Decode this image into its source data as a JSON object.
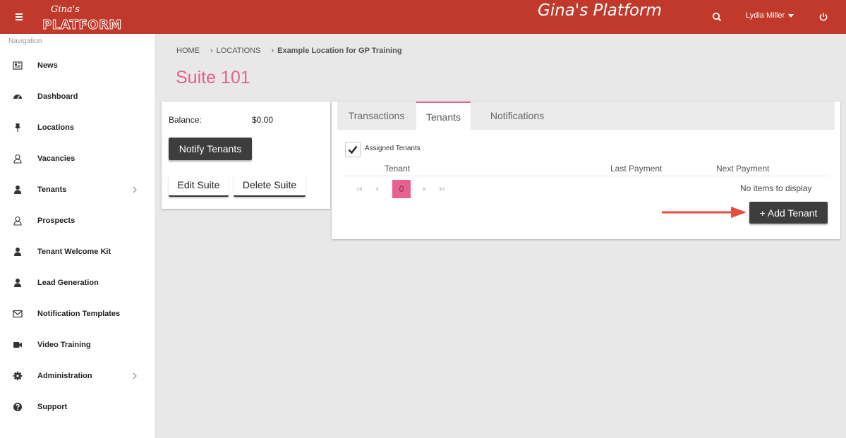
{
  "header": {
    "logo_script": "Gina's",
    "logo_word": "PLATFORM",
    "app_title": "Gina's Platform",
    "user_name": "Lydia Miller",
    "icons": [
      "menu-icon",
      "search-icon",
      "power-icon"
    ]
  },
  "sidebar": {
    "heading": "Navigation",
    "items": [
      {
        "label": "News",
        "icon": "newspaper-icon"
      },
      {
        "label": "Dashboard",
        "icon": "gauge-icon"
      },
      {
        "label": "Locations",
        "icon": "pin-icon"
      },
      {
        "label": "Vacancies",
        "icon": "user-outline-icon"
      },
      {
        "label": "Tenants",
        "icon": "user-icon",
        "has_children": true
      },
      {
        "label": "Prospects",
        "icon": "user-outline-icon"
      },
      {
        "label": "Tenant Welcome Kit",
        "icon": "user-icon"
      },
      {
        "label": "Lead Generation",
        "icon": "user-icon"
      },
      {
        "label": "Notification Templates",
        "icon": "envelope-icon"
      },
      {
        "label": "Video Training",
        "icon": "video-camera-icon"
      },
      {
        "label": "Administration",
        "icon": "gear-icon",
        "has_children": true
      },
      {
        "label": "Support",
        "icon": "question-icon"
      }
    ]
  },
  "breadcrumb": {
    "home": "HOME",
    "locations": "LOCATIONS",
    "current": "Example Location for GP Training"
  },
  "page": {
    "title": "Suite 101"
  },
  "suite_card": {
    "balance_label": "Balance:",
    "balance_value": "$0.00",
    "notify_label": "Notify Tenants",
    "edit_label": "Edit Suite",
    "delete_label": "Delete Suite"
  },
  "tabs": {
    "items": [
      {
        "label": "Transactions",
        "active": false
      },
      {
        "label": "Tenants",
        "active": true
      },
      {
        "label": "Notifications",
        "active": false
      }
    ],
    "accent_color": "#e8608d"
  },
  "tenants": {
    "checkbox_label": "Assigned Tenants",
    "checkbox_checked": true,
    "columns": [
      "Tenant",
      "Last Payment",
      "Next Payment"
    ],
    "current_page": "0",
    "empty_text": "No items to display",
    "add_label": "+ Add Tenant"
  },
  "colors": {
    "header_bg": "#c0392b",
    "accent_pink": "#e8608d",
    "dark_button": "#3d3d3d",
    "annotation_arrow": "#e74c3c"
  }
}
